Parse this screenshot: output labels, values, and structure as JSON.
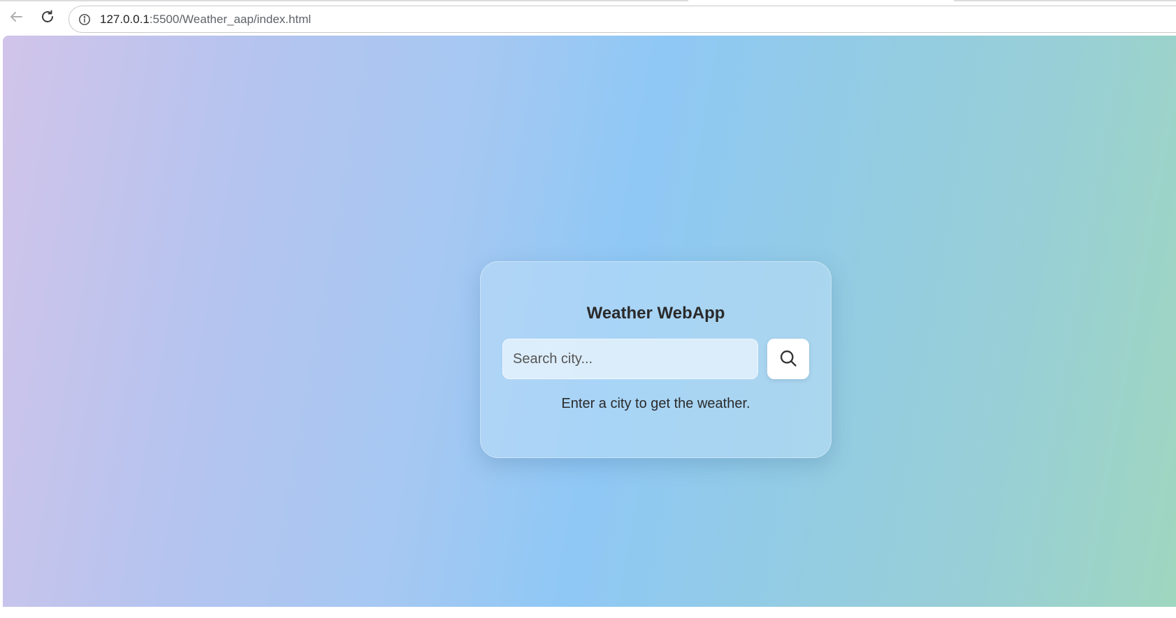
{
  "browser": {
    "url_host": "127.0.0.1",
    "url_rest": ":5500/Weather_aap/index.html"
  },
  "app": {
    "title": "Weather WebApp",
    "search": {
      "placeholder": "Search city...",
      "value": ""
    },
    "status_message": "Enter a city to get the weather."
  },
  "icons": {
    "back": "arrow-left-icon",
    "reload": "reload-icon",
    "site_info": "info-icon",
    "search": "search-icon"
  },
  "colors": {
    "gradient_start": "#d1c4ea",
    "gradient_mid": "#8fc8f5",
    "gradient_end": "#9fd6bf"
  }
}
